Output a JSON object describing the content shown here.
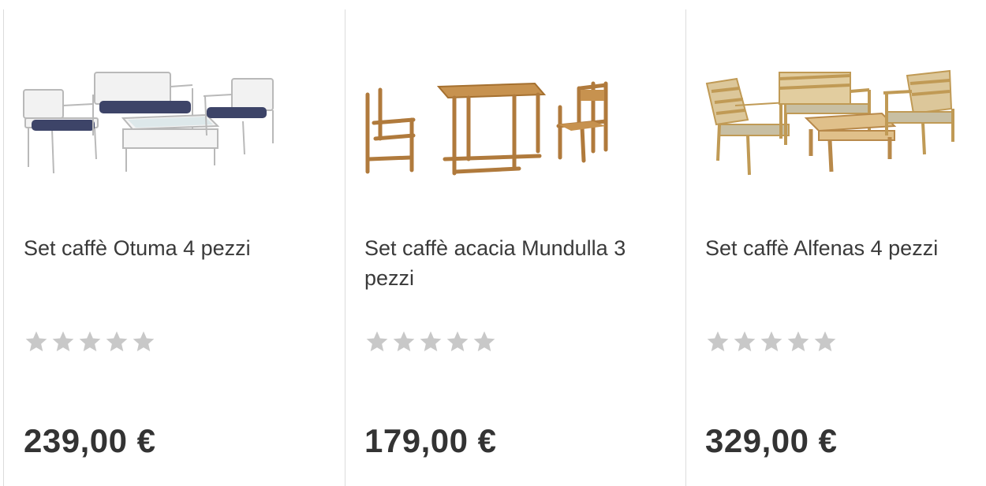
{
  "products": [
    {
      "name": "Set caffè Otuma 4 pezzi",
      "price": "239,00 €",
      "rating": 0,
      "rating_max": 5,
      "image_icon": "white-rattan-lounge-set-image"
    },
    {
      "name": "Set caffè acacia Mundulla 3 pezzi",
      "price": "179,00 €",
      "rating": 0,
      "rating_max": 5,
      "image_icon": "acacia-table-chairs-image"
    },
    {
      "name": "Set caffè Alfenas 4 pezzi",
      "price": "329,00 €",
      "rating": 0,
      "rating_max": 5,
      "image_icon": "wooden-lounge-set-image"
    }
  ],
  "colors": {
    "star_empty": "#c8c8c8",
    "divider": "#dcdcdc",
    "text": "#333333"
  }
}
